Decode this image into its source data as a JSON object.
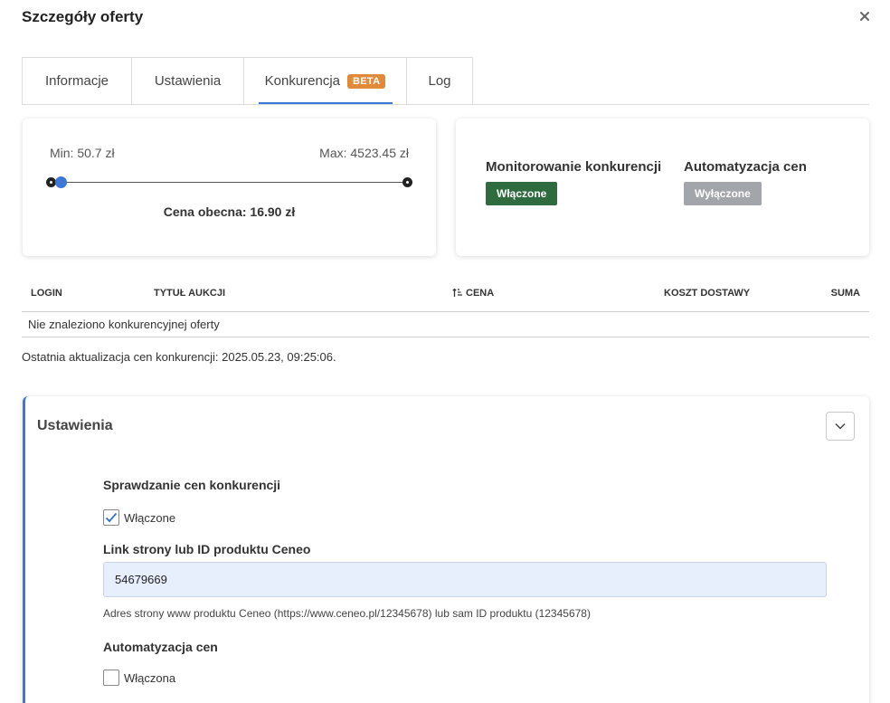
{
  "modal": {
    "title": "Szczegóły oferty"
  },
  "tabs": [
    {
      "label": "Informacje"
    },
    {
      "label": "Ustawienia"
    },
    {
      "label": "Konkurencja",
      "badge": "BETA"
    },
    {
      "label": "Log"
    }
  ],
  "price_card": {
    "min_label": "Min: 50.7 zł",
    "max_label": "Max: 4523.45 zł",
    "current_label": "Cena obecna: 16.90 zł",
    "slider": {
      "min": 50.7,
      "max": 4523.45,
      "current": 16.9
    }
  },
  "status_card": {
    "monitoring": {
      "label": "Monitorowanie konkurencji",
      "status": "Włączone"
    },
    "automation": {
      "label": "Automatyzacja cen",
      "status": "Wyłączone"
    }
  },
  "table": {
    "columns": [
      "LOGIN",
      "TYTUŁ AUKCJI",
      "CENA",
      "KOSZT DOSTAWY",
      "SUMA"
    ],
    "sorted_column": "CENA",
    "empty_message": "Nie znaleziono konkurencyjnej oferty"
  },
  "last_update": "Ostatnia aktualizacja cen konkurencji: 2025.05.23, 09:25:06.",
  "settings_panel": {
    "title": "Ustawienia",
    "price_check": {
      "label": "Sprawdzanie cen konkurencji",
      "checkbox_label": "Włączone",
      "checked": true
    },
    "ceneo_link": {
      "label": "Link strony lub ID produktu Ceneo",
      "value": "54679669",
      "help": "Adres strony www produktu Ceneo (https://www.ceneo.pl/12345678) lub sam ID produktu (12345678)"
    },
    "price_automation": {
      "label": "Automatyzacja cen",
      "checkbox_label": "Włączona",
      "checked": false
    }
  },
  "colors": {
    "accent": "#3b78d8",
    "beta_badge": "#e08a3a",
    "enabled_badge": "#2e6b3f",
    "disabled_badge": "#a2a6ab",
    "input_bg": "#e8effc"
  },
  "icons": [
    "close-icon",
    "sort-ascending-icon",
    "chevron-down-icon",
    "checkmark-icon"
  ]
}
